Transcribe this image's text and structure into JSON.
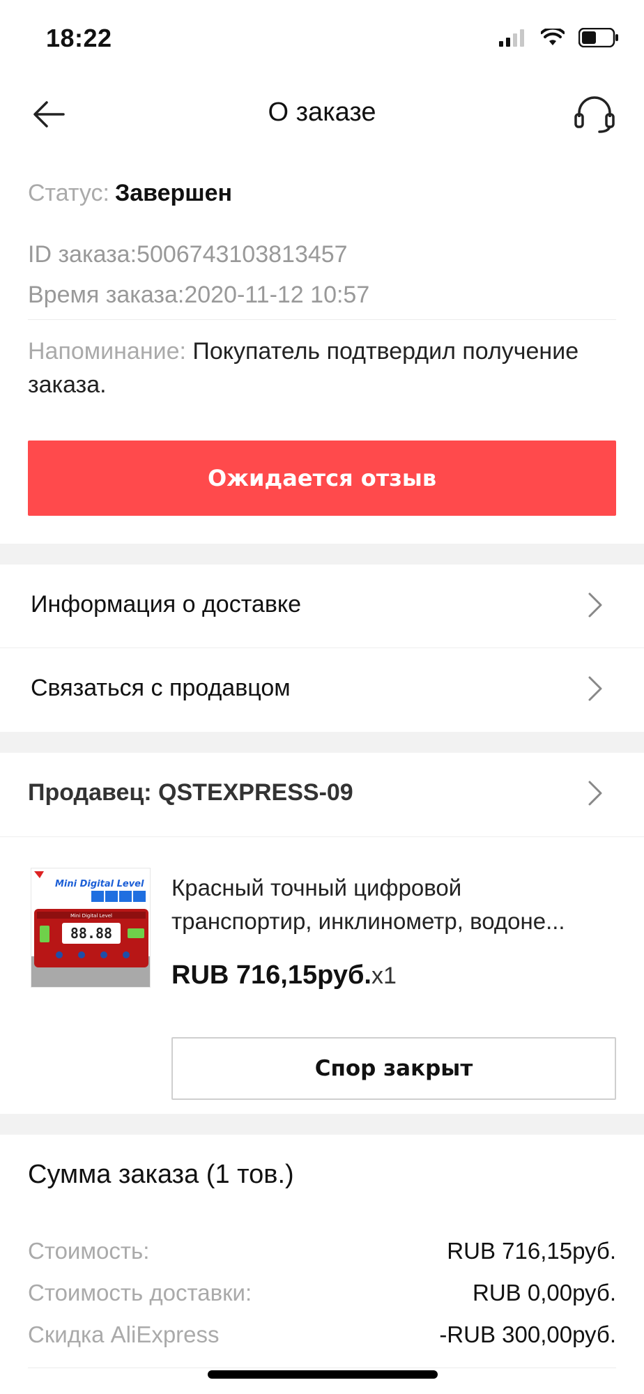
{
  "status_bar": {
    "time": "18:22"
  },
  "nav": {
    "title": "О заказе"
  },
  "order": {
    "status_label": "Статус:",
    "status_value": "Завершен",
    "id_line": "ID заказа:5006743103813457",
    "time_line": "Время заказа:2020-11-12 10:57",
    "reminder_label": "Напоминание:",
    "reminder_text": "Покупатель подтвердил получение заказа."
  },
  "cta": {
    "label": "Ожидается отзыв",
    "color": "#ff4a4c"
  },
  "links": [
    {
      "label": "Информация о доставке"
    },
    {
      "label": "Связаться с продавцом"
    }
  ],
  "seller": {
    "label": "Продавец: QSTEXPRESS-09"
  },
  "product": {
    "title_line1": "Красный точный цифровой",
    "title_line2": "транспортир, инклинометр, водоне...",
    "price": "RUB 716,15руб.",
    "qty": "x1",
    "thumb_text": "Mini Digital Level",
    "thumb_sub": "Mini Digital Level",
    "thumb_readout": "88.88"
  },
  "dispute": {
    "label": "Спор закрыт"
  },
  "summary": {
    "title": "Сумма заказа (1 тов.)",
    "rows": [
      {
        "key": "Стоимость:",
        "value": "RUB 716,15руб."
      },
      {
        "key": "Стоимость доставки:",
        "value": "RUB 0,00руб."
      },
      {
        "key": "Скидка AliExpress",
        "value": "-RUB 300,00руб."
      }
    ]
  }
}
